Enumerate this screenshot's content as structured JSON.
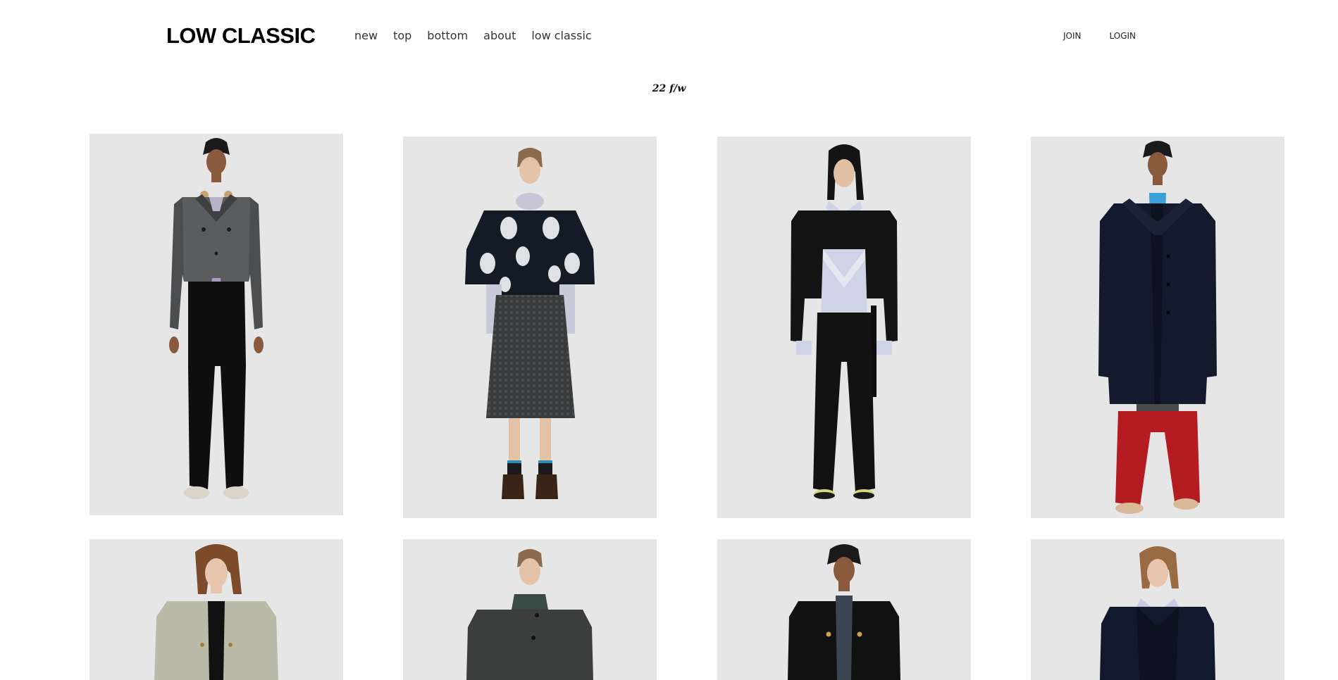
{
  "brand": {
    "logo_text": "LOW CLASSIC"
  },
  "nav": {
    "items": [
      {
        "label": "new"
      },
      {
        "label": "top"
      },
      {
        "label": "bottom"
      },
      {
        "label": "about"
      },
      {
        "label": "low classic"
      }
    ]
  },
  "account": {
    "join_label": "JOIN",
    "login_label": "LOGIN"
  },
  "collection": {
    "title": "22 f/w"
  },
  "colors": {
    "page_background": "#ffffff",
    "card_background": "#e6e6e6",
    "text": "#111111"
  },
  "products": [
    {
      "outfit": "grey check cropped jacket, lilac tie, black flared trousers"
    },
    {
      "outfit": "navy embroidered short-sleeve jacket, check skirt, brown boots"
    },
    {
      "outfit": "black cropped blazer, pale blue shirt, black wide trousers"
    },
    {
      "outfit": "navy long coat, blue shirt, red wide trousers"
    },
    {
      "outfit": "light tweed jacket, black top"
    },
    {
      "outfit": "grey check high-neck coat"
    },
    {
      "outfit": "black jacket with gold buttons"
    },
    {
      "outfit": "navy jacket with pale blue collar"
    }
  ]
}
